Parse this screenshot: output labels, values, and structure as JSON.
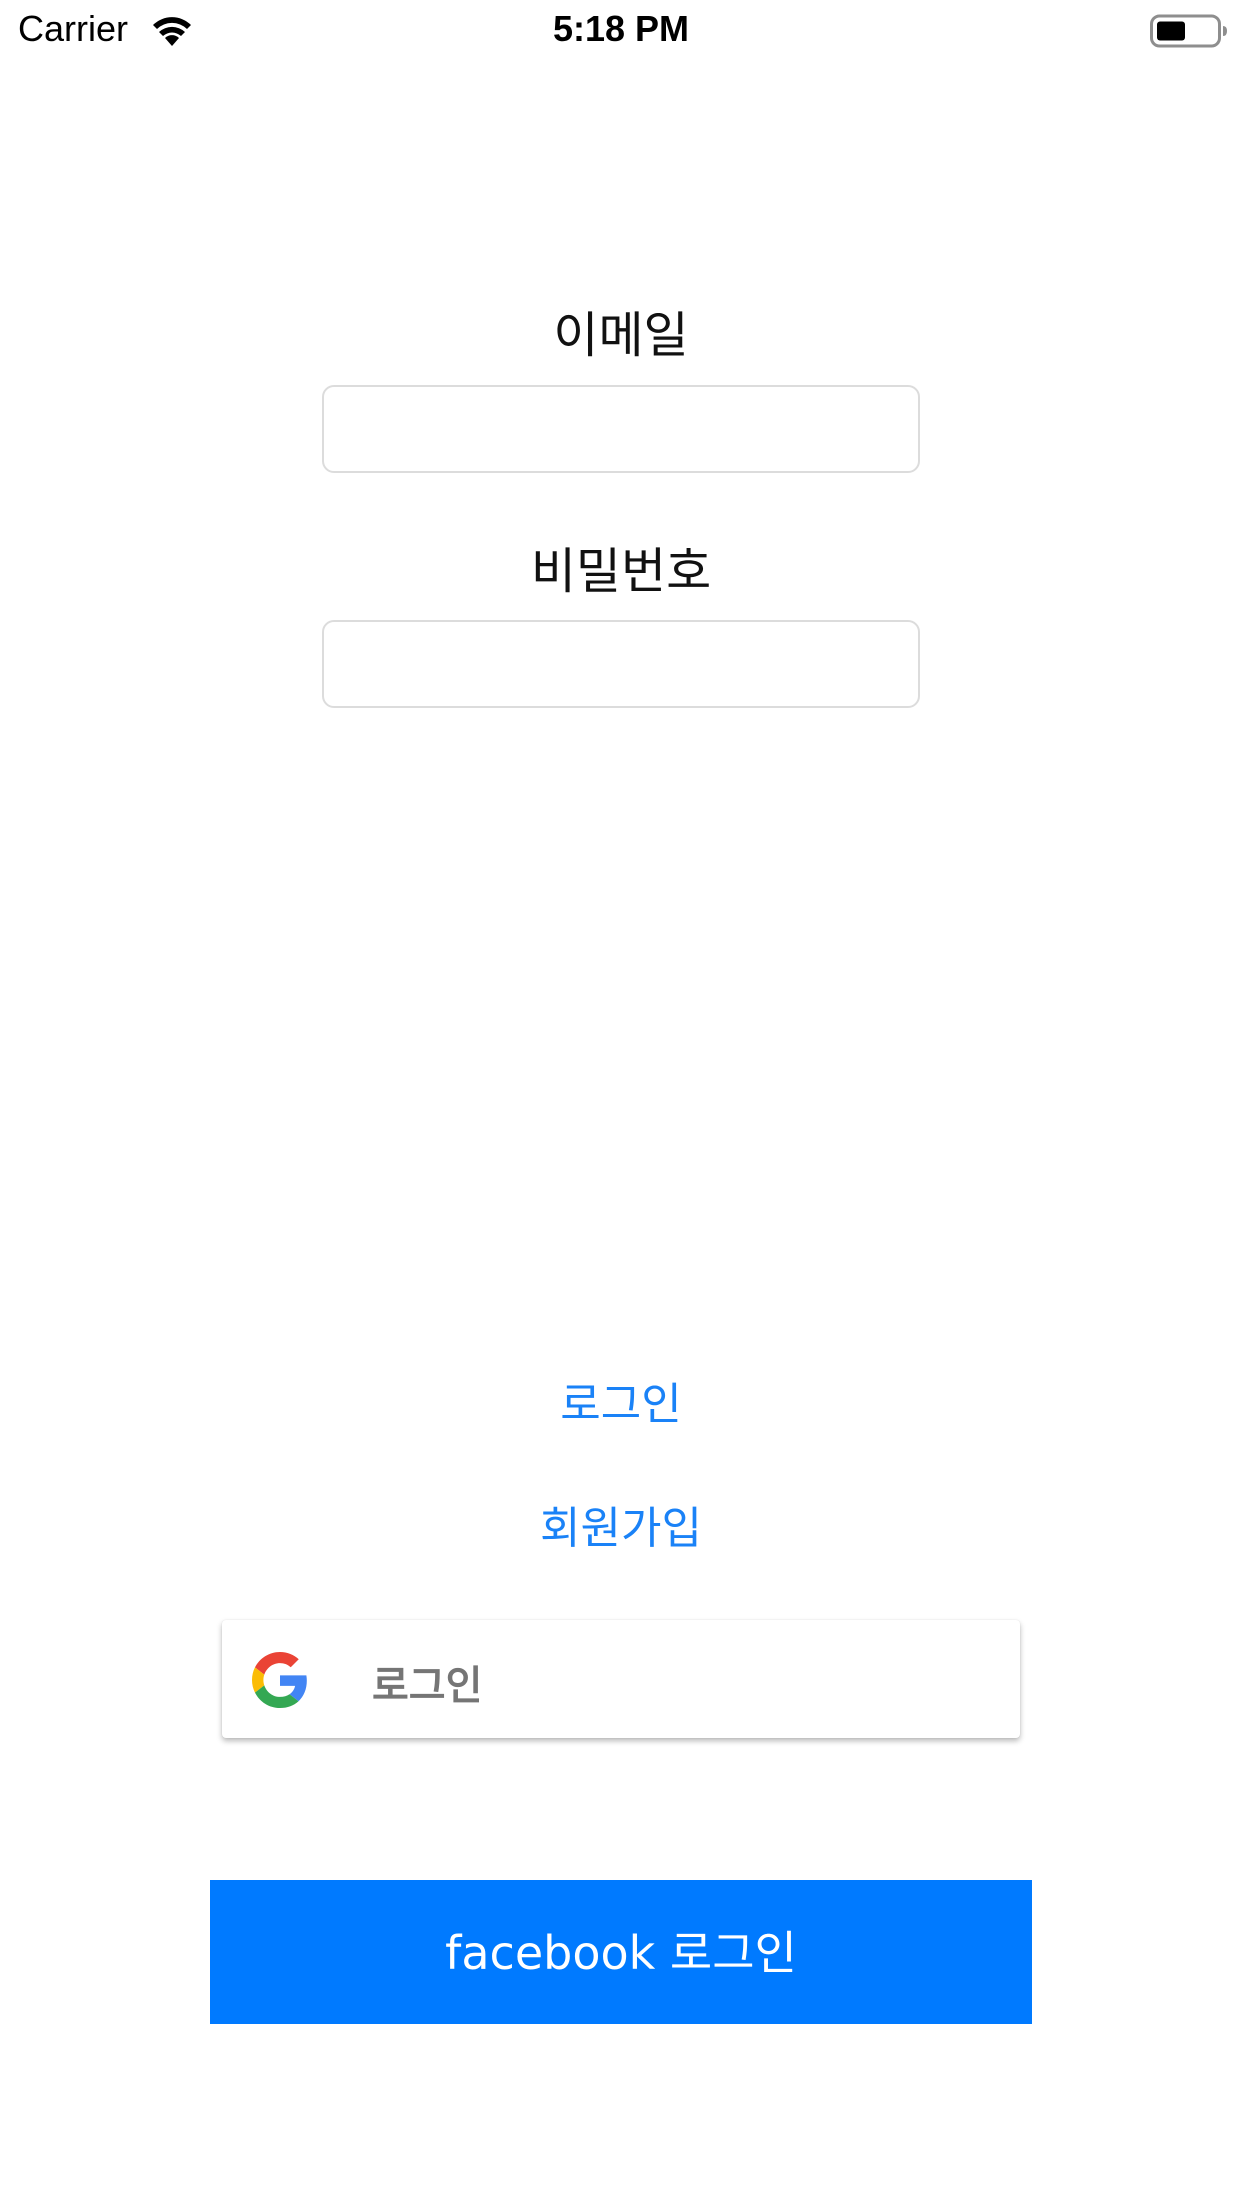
{
  "status_bar": {
    "carrier": "Carrier",
    "time": "5:18 PM",
    "wifi_icon": "wifi-icon",
    "battery_icon": "battery-icon"
  },
  "form": {
    "email_label": "이메일",
    "email_value": "",
    "password_label": "비밀번호",
    "password_value": ""
  },
  "actions": {
    "login_label": "로그인",
    "signup_label": "회원가입"
  },
  "google_button": {
    "icon": "google-g-icon",
    "label": "로그인"
  },
  "facebook_button": {
    "label": "facebook 로그인",
    "color": "#007aff"
  },
  "colors": {
    "link": "#1a82f7",
    "google_label": "#757575"
  }
}
